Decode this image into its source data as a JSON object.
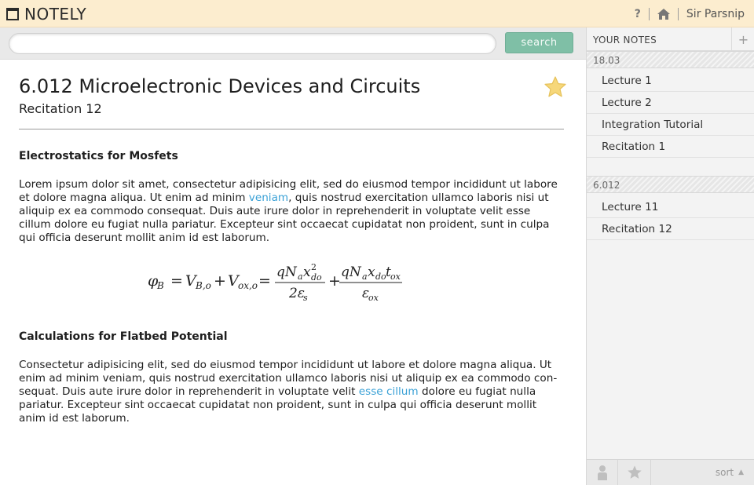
{
  "app": {
    "name": "NOTELY"
  },
  "header": {
    "help_label": "?",
    "user_name": "Sir Parsnip"
  },
  "search": {
    "placeholder": "",
    "value": "",
    "button_label": "search"
  },
  "note": {
    "title": "6.012 Microelectronic Devices and Circuits",
    "subtitle": "Recitation 12",
    "sections": [
      {
        "heading": "Electrostatics for Mosfets",
        "para_before": "Lorem ipsum dolor sit amet, consectetur adipisicing elit, sed do eiusmod tempor incididunt ut labore et dolore magna aliqua. Ut enim ad minim ",
        "link": "veniam",
        "para_after": ", quis nostrud exercitation ullamco laboris nisi ut aliquip ex ea commodo consequat. Duis aute irure dolor in reprehenderit in voluptate velit esse cillum dolore eu fugiat nulla pariatur. Excepteur sint occaecat cupidatat non proident, sunt in culpa qui officia deserunt mollit anim id est laborum."
      },
      {
        "heading": "Calculations for Flatbed Potential",
        "para_before": "Consectetur adipisicing elit, sed do eiusmod tempor incididunt ut labore et dolore magna aliqua. Ut enim ad minim veniam, quis nostrud exercitation ullamco laboris nisi ut aliquip ex ea commodo con-sequat. Duis aute irure dolor in reprehenderit in voluptate velit ",
        "link": "esse cillum",
        "para_after": " dolore eu fugiat nulla pariatur. Excepteur sint occaecat cupidatat non proident, sunt in culpa qui officia deserunt mollit anim id est laborum."
      }
    ],
    "equation": {
      "lhs": "φ",
      "lhs_sub": "B",
      "eq1": "=",
      "v1": "V",
      "v1_sub": "B,o",
      "plus1": "+",
      "v2": "V",
      "v2_sub": "ox,o",
      "eq2": "=",
      "frac1_num_a": "qN",
      "frac1_num_a_sub": "a",
      "frac1_num_b": "x",
      "frac1_num_b_sup": "2",
      "frac1_num_b_sub": "do",
      "frac1_den_a": "2ε",
      "frac1_den_a_sub": "s",
      "plus2": "+",
      "frac2_num_a": "qN",
      "frac2_num_a_sub": "a",
      "frac2_num_b": "x",
      "frac2_num_b_sub": "do",
      "frac2_num_c": "t",
      "frac2_num_c_sub": "ox",
      "frac2_den_a": "ε",
      "frac2_den_a_sub": "ox"
    }
  },
  "sidebar": {
    "title": "YOUR NOTES",
    "add_label": "+",
    "groups": [
      {
        "name": "18.03",
        "items": [
          "Lecture 1",
          "Lecture 2",
          "Integration Tutorial",
          "Recitation 1"
        ]
      },
      {
        "name": "6.012",
        "items": [
          "Lecture 11",
          "Recitation 12"
        ]
      }
    ],
    "sort_label": "sort"
  },
  "colors": {
    "topbar": "#fcedcf",
    "accent_button": "#7fbfa6",
    "link": "#3aa1d6",
    "star": "#f6d77a"
  }
}
